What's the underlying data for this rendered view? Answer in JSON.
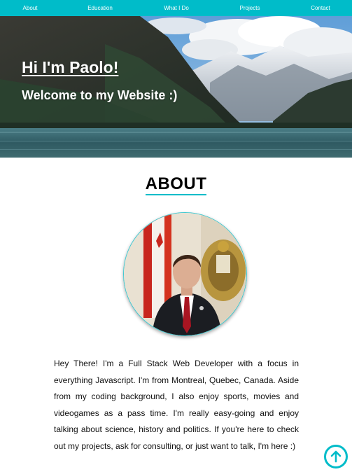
{
  "nav": {
    "items": [
      {
        "label": "About"
      },
      {
        "label": "Education"
      },
      {
        "label": "What I Do"
      },
      {
        "label": "Projects"
      },
      {
        "label": "Contact"
      }
    ]
  },
  "hero": {
    "title": "Hi I'm Paolo!",
    "subtitle": "Welcome to my Website :)"
  },
  "about": {
    "heading": "ABOUT",
    "bio": "Hey There! I'm a Full Stack Web Developer with a focus in everything Javascript. I'm from Montreal, Quebec, Canada. Aside from my coding background, I also enjoy sports, movies and videogames as a pass time. I'm really easy-going and enjoy talking about science, history and politics. If you're here to check out my projects, ask for consulting, or just want to talk, I'm here :)"
  },
  "colors": {
    "accent": "#00bcc9",
    "nav_text": "#ffffff"
  },
  "icons": {
    "scroll_top": "arrow-up-circle-icon"
  }
}
